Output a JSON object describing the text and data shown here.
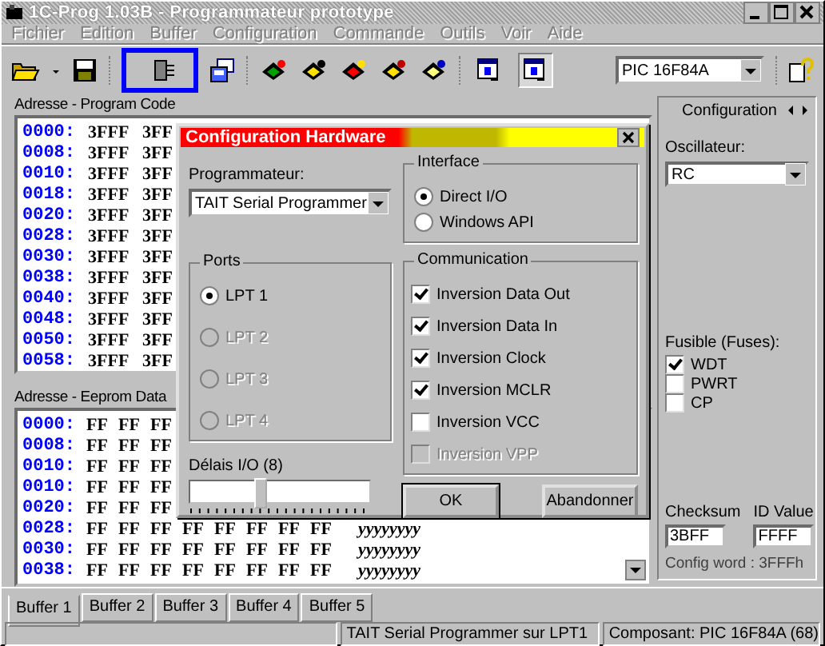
{
  "window": {
    "title": "1C-Prog 1.03B - Programmateur prototype",
    "active": false
  },
  "menu": [
    "Fichier",
    "Edition",
    "Buffer",
    "Configuration",
    "Commande",
    "Outils",
    "Voir",
    "Aide"
  ],
  "toolbar": {
    "view_toggles": [
      {
        "selected": false
      },
      {
        "selected": true
      }
    ],
    "device": "PIC 16F84A"
  },
  "program_code": {
    "label": "Adresse - Program Code",
    "rows": [
      {
        "address": "0000:",
        "cells": [
          "3FFF",
          "3FF"
        ]
      },
      {
        "address": "0008:",
        "cells": [
          "3FFF",
          "3FF"
        ]
      },
      {
        "address": "0010:",
        "cells": [
          "3FFF",
          "3FF"
        ]
      },
      {
        "address": "0018:",
        "cells": [
          "3FFF",
          "3FF"
        ]
      },
      {
        "address": "0020:",
        "cells": [
          "3FFF",
          "3FF"
        ]
      },
      {
        "address": "0028:",
        "cells": [
          "3FFF",
          "3FF"
        ]
      },
      {
        "address": "0030:",
        "cells": [
          "3FFF",
          "3FF"
        ]
      },
      {
        "address": "0038:",
        "cells": [
          "3FFF",
          "3FF"
        ]
      },
      {
        "address": "0040:",
        "cells": [
          "3FFF",
          "3FF"
        ]
      },
      {
        "address": "0048:",
        "cells": [
          "3FFF",
          "3FF"
        ]
      },
      {
        "address": "0050:",
        "cells": [
          "3FFF",
          "3FF"
        ]
      },
      {
        "address": "0058:",
        "cells": [
          "3FFF",
          "3FF"
        ]
      }
    ]
  },
  "eeprom_data": {
    "label": "Adresse - Eeprom Data",
    "rows": [
      {
        "address": "0000:",
        "cells": [
          "FF",
          "FF",
          "FF"
        ]
      },
      {
        "address": "0008:",
        "cells": [
          "FF",
          "FF",
          "FF"
        ]
      },
      {
        "address": "0010:",
        "cells": [
          "FF",
          "FF",
          "FF"
        ]
      },
      {
        "address": "0010:",
        "cells": [
          "FF",
          "FF",
          "FF"
        ]
      },
      {
        "address": "0020:",
        "cells": [
          "FF",
          "FF",
          "FF"
        ]
      },
      {
        "address": "0028:",
        "cells": [
          "FF",
          "FF",
          "FF",
          "FF",
          "FF",
          "FF",
          "FF",
          "FF"
        ],
        "ascii": "yyyyyyyy"
      },
      {
        "address": "0030:",
        "cells": [
          "FF",
          "FF",
          "FF",
          "FF",
          "FF",
          "FF",
          "FF",
          "FF"
        ],
        "ascii": "yyyyyyyy"
      },
      {
        "address": "0038:",
        "cells": [
          "FF",
          "FF",
          "FF",
          "FF",
          "FF",
          "FF",
          "FF",
          "FF"
        ],
        "ascii": "yyyyyyyy"
      }
    ]
  },
  "configuration": {
    "title": "Configuration",
    "oscillator_label": "Oscillateur:",
    "oscillator": "RC",
    "fuses_label": "Fusible (Fuses):",
    "fuses": [
      {
        "label": "WDT",
        "checked": true
      },
      {
        "label": "PWRT",
        "checked": false
      },
      {
        "label": "CP",
        "checked": false
      }
    ],
    "checksum_label": "Checksum",
    "checksum": "3BFF",
    "id_label": "ID Value",
    "id_value": "FFFF",
    "config_word": "Config word : 3FFFh"
  },
  "tabs": [
    {
      "label": "Buffer 1",
      "selected": true
    },
    {
      "label": "Buffer 2",
      "selected": false
    },
    {
      "label": "Buffer 3",
      "selected": false
    },
    {
      "label": "Buffer 4",
      "selected": false
    },
    {
      "label": "Buffer 5",
      "selected": false
    }
  ],
  "status_bar": [
    "TAIT Serial Programmer sur LPT1",
    "Composant: PIC 16F84A  (68)"
  ],
  "dialog": {
    "title": "Configuration Hardware",
    "programmer_label": "Programmateur:",
    "programmer": "TAIT Serial Programmer",
    "interface": {
      "title": "Interface",
      "options": [
        {
          "label": "Direct I/O",
          "selected": true
        },
        {
          "label": "Windows API",
          "selected": false
        }
      ]
    },
    "ports": {
      "title": "Ports",
      "options": [
        {
          "label": "LPT 1",
          "selected": true,
          "disabled": false
        },
        {
          "label": "LPT 2",
          "selected": false,
          "disabled": true
        },
        {
          "label": "LPT 3",
          "selected": false,
          "disabled": true
        },
        {
          "label": "LPT 4",
          "selected": false,
          "disabled": true
        }
      ]
    },
    "delay": {
      "label": "Délais I/O  (8)",
      "level": 0.38
    },
    "communication": {
      "title": "Communication",
      "options": [
        {
          "label": "Inversion Data Out",
          "checked": true,
          "disabled": false
        },
        {
          "label": "Inversion Data In",
          "checked": true,
          "disabled": false
        },
        {
          "label": "Inversion Clock",
          "checked": true,
          "disabled": false
        },
        {
          "label": "Inversion MCLR",
          "checked": true,
          "disabled": false
        },
        {
          "label": "Inversion VCC",
          "checked": false,
          "disabled": false
        },
        {
          "label": "Inversion VPP",
          "checked": false,
          "disabled": true
        }
      ]
    },
    "buttons": [
      "OK",
      "Abandonner"
    ]
  }
}
